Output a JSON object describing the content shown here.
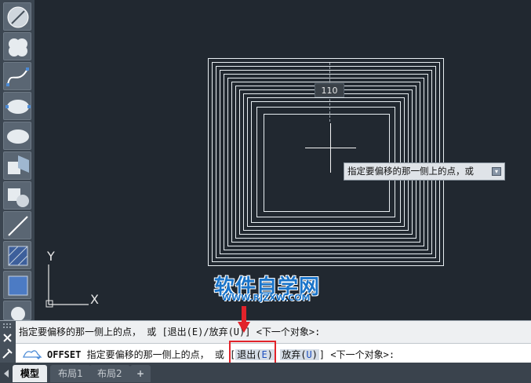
{
  "toolbar": {
    "tools": [
      {
        "name": "line-tool"
      },
      {
        "name": "revision-cloud-tool"
      },
      {
        "name": "spline-tool"
      },
      {
        "name": "ellipse-tool"
      },
      {
        "name": "ellipse-arc-tool"
      },
      {
        "name": "insert-block-tool"
      },
      {
        "name": "make-block-tool"
      },
      {
        "name": "xline-tool"
      },
      {
        "name": "hatch-tool"
      },
      {
        "name": "gradient-tool"
      },
      {
        "name": "region-tool"
      }
    ]
  },
  "canvas": {
    "dimension_value": "110",
    "tooltip": "指定要偏移的那一侧上的点，或",
    "ucs_x": "X",
    "ucs_y": "Y",
    "watermark_line1": "软件自学网",
    "watermark_line2": "WWW.RJZXW.COM"
  },
  "command": {
    "history": "指定要偏移的那一侧上的点， 或 [退出(E)/放弃(U)] <下一个对象>:",
    "current_cmd": "OFFSET",
    "current_prompt": "指定要偏移的那一侧上的点， 或 [",
    "option1_text": "退出(",
    "option1_key": "E",
    "option2_text": "放弃(",
    "option2_key": "U",
    "suffix": "] <下一个对象>:"
  },
  "tabs": [
    "模型",
    "布局1",
    "布局2"
  ],
  "add_tab": "+",
  "colors": {
    "background": "#212830",
    "accent": "#1a74c9",
    "highlight": "#e2232a"
  }
}
